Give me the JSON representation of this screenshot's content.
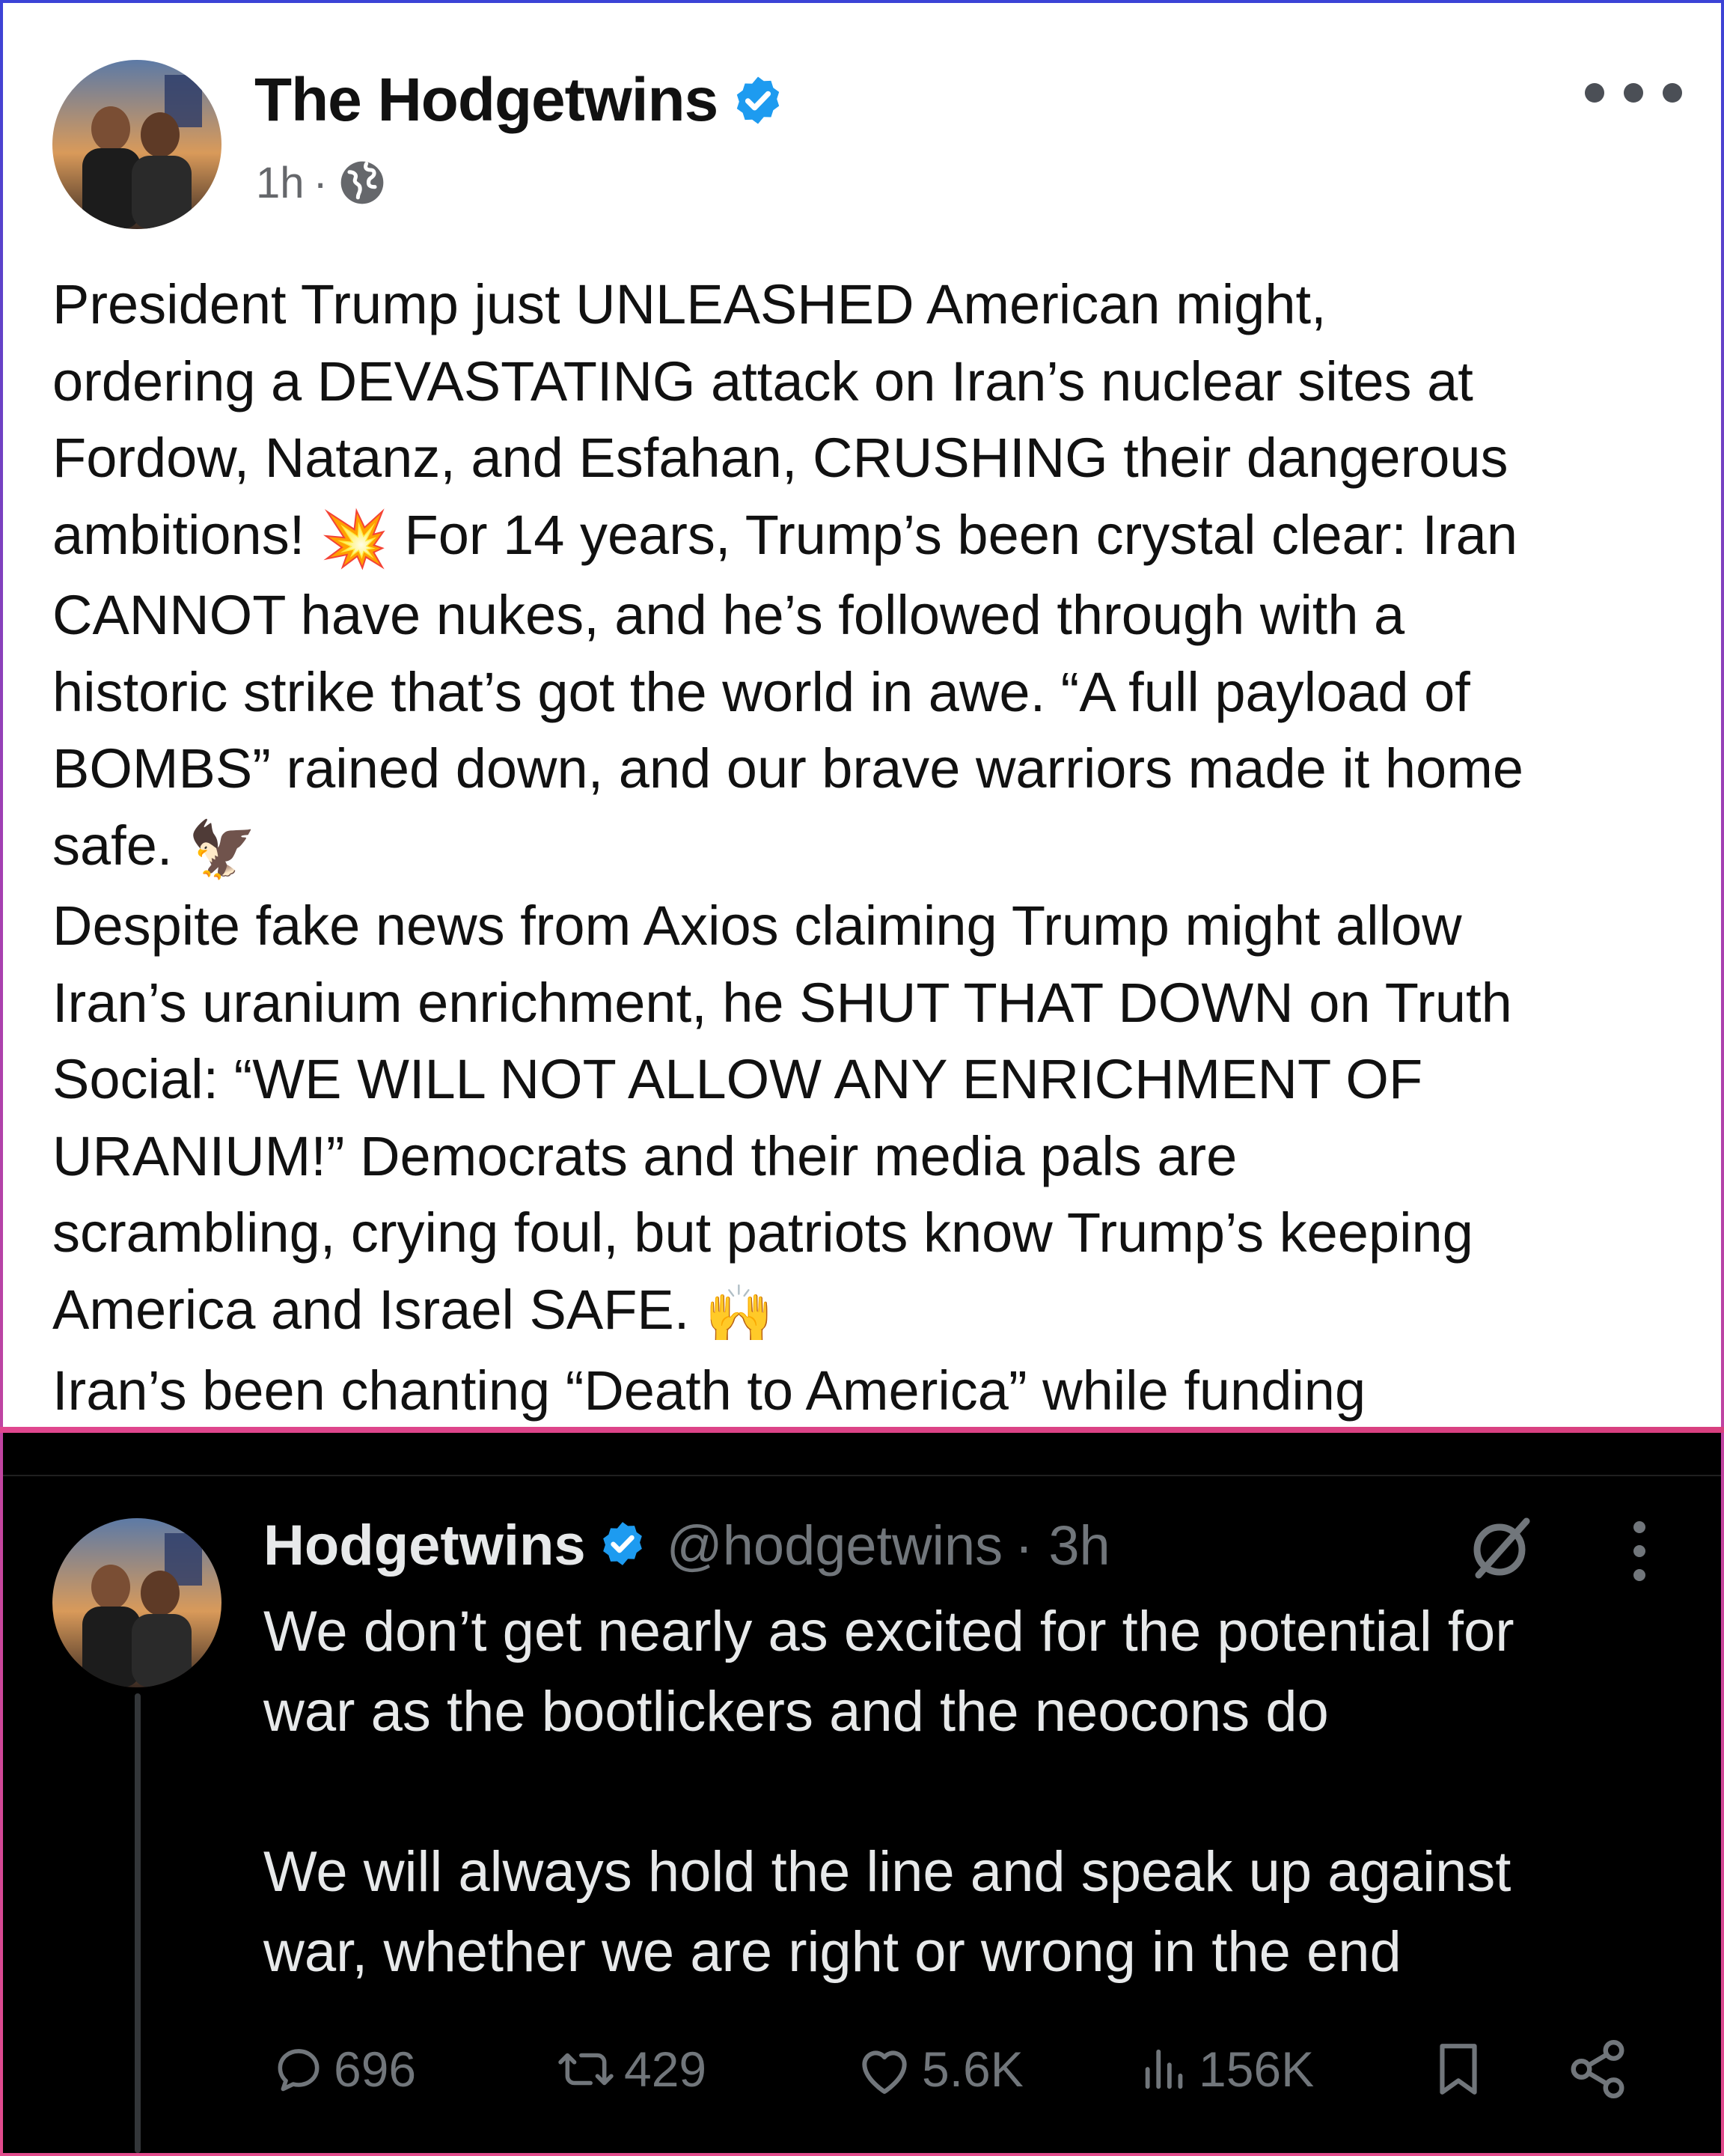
{
  "facebook_post": {
    "author": "The Hodgetwins",
    "time": "1h",
    "separator": "·",
    "body_lines": [
      "President Trump just UNLEASHED American might,",
      "ordering a DEVASTATING attack on Iran’s nuclear sites at",
      "Fordow, Natanz, and Esfahan, CRUSHING their dangerous",
      "ambitions!",
      "For 14 years, Trump’s been crystal clear: Iran",
      "CANNOT have nukes, and he’s followed through with a",
      "historic strike that’s got the world in awe. “A full payload of",
      "BOMBS” rained down, and our brave warriors made it home",
      "safe.",
      "Despite fake news from Axios claiming Trump might allow",
      "Iran’s uranium enrichment, he SHUT THAT DOWN on Truth",
      "Social: “WE WILL NOT ALLOW ANY ENRICHMENT OF",
      "URANIUM!” Democrats and their media pals are",
      "scrambling, crying foul, but patriots know Trump’s keeping",
      "America and Israel SAFE.",
      "Iran’s been chanting “Death to America” while funding"
    ],
    "emojis": {
      "collision": "💥",
      "eagle": "🦅",
      "raised_hands": "🙌"
    },
    "icons": [
      "verified-badge-icon",
      "globe-icon",
      "more-options-icon"
    ]
  },
  "x_post": {
    "name": "Hodgetwins",
    "handle": "@hodgetwins",
    "time": "· 3h",
    "body_paragraphs": [
      [
        "We don’t get nearly as excited for the potential for",
        "war as the bootlickers and the neocons do"
      ],
      [
        "We will always hold the line and speak up against",
        "war, whether we are right or wrong in the end"
      ]
    ],
    "stats": {
      "replies": "696",
      "reposts": "429",
      "likes": "5.6K",
      "views": "156K"
    },
    "icons": [
      "verified-badge-icon",
      "grok-icon",
      "more-options-icon",
      "reply-icon",
      "repost-icon",
      "like-icon",
      "views-icon",
      "bookmark-icon",
      "share-icon"
    ]
  },
  "colors": {
    "frame_top": "#3b43d6",
    "frame_bottom": "#e24b8c",
    "verified_blue": "#1d9bf0",
    "fb_text": "#111111",
    "fb_meta": "#65676b",
    "x_text": "#e7e9ea",
    "x_secondary": "#71767b"
  }
}
